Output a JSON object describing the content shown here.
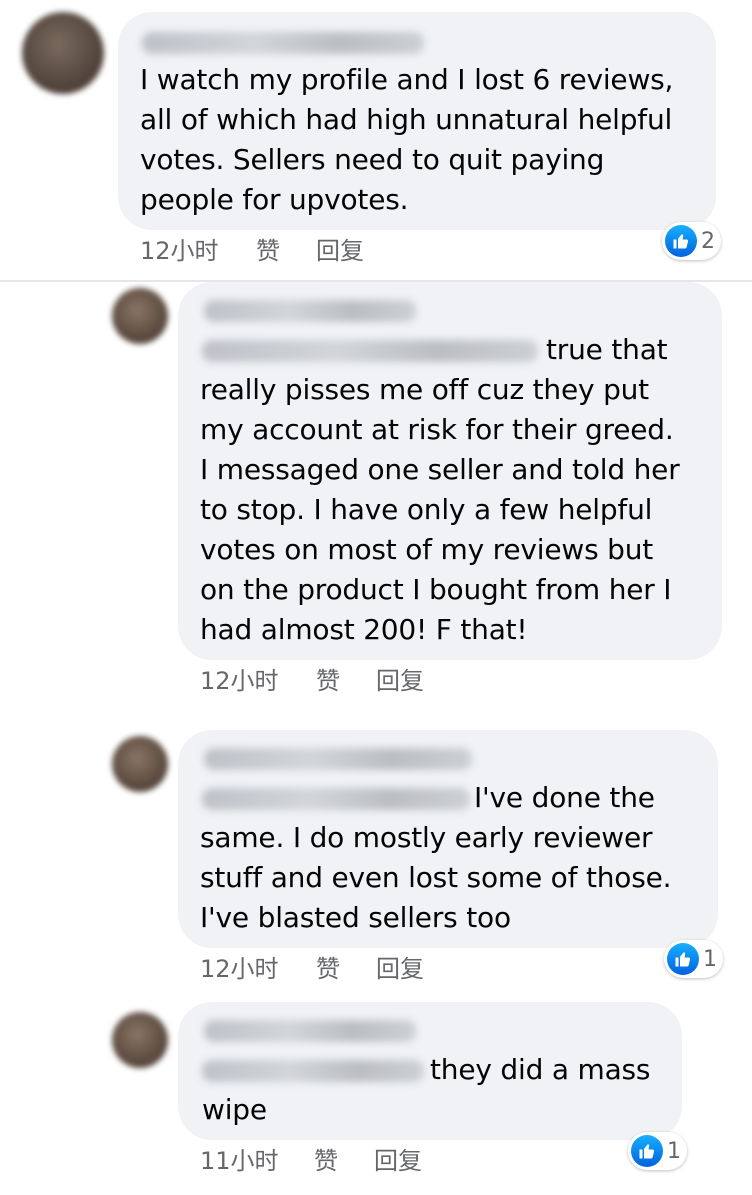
{
  "comments": [
    {
      "lines": [
        "I watch my profile and I lost 6 reviews,",
        "all of which had high unnatural helpful",
        "votes. Sellers need to quit paying",
        "people for upvotes."
      ],
      "time": "12小时",
      "like": "赞",
      "reply": "回复",
      "reaction_count": "2"
    },
    {
      "lines": [
        "true that",
        "really pisses me off cuz they put",
        "my account at risk for their greed.",
        "I messaged one seller and told her",
        "to stop. I have only a few helpful",
        "votes on most of my reviews but",
        "on the product I bought from her I",
        "had almost 200! F that!"
      ],
      "time": "12小时",
      "like": "赞",
      "reply": "回复"
    },
    {
      "lines": [
        "I've done the",
        "same. I do mostly early reviewer",
        "stuff and even lost some of those.",
        "I've blasted sellers too"
      ],
      "time": "12小时",
      "like": "赞",
      "reply": "回复",
      "reaction_count": "1"
    },
    {
      "lines": [
        "they did a mass",
        "wipe"
      ],
      "time": "11小时",
      "like": "赞",
      "reply": "回复",
      "reaction_count": "1"
    }
  ],
  "colors": {
    "bubble": "#f0f2f5",
    "meta_text": "#65676b",
    "like_blue": "#0571ed"
  },
  "icons": [
    "thumbs-up-icon"
  ]
}
